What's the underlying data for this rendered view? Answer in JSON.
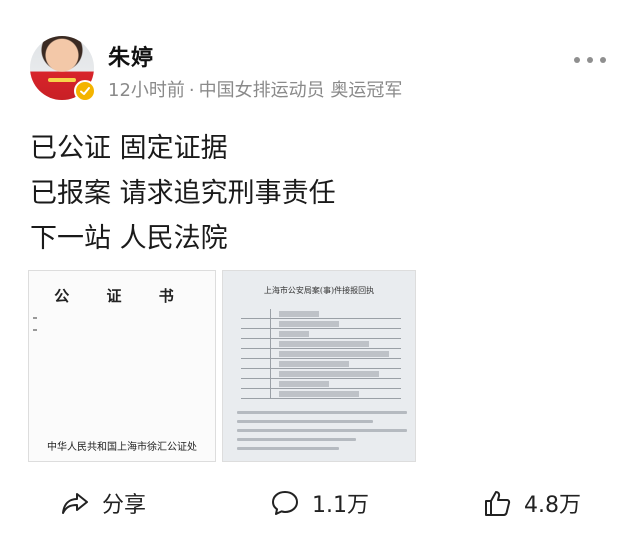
{
  "post": {
    "author": {
      "name": "朱婷",
      "verified": true
    },
    "meta": {
      "time": "12小时前",
      "separator": "·",
      "bio": "中国女排运动员 奥运冠军"
    },
    "text_lines": [
      "已公证 固定证据",
      "已报案 请求追究刑事责任",
      "下一站 人民法院"
    ],
    "images": [
      {
        "title": "公 证 书",
        "footer": "中华人民共和国上海市徐汇公证处"
      },
      {
        "title": "上海市公安局案(事)件接报回执"
      }
    ]
  },
  "actions": {
    "share": {
      "label": "分享",
      "icon": "share-icon"
    },
    "comment": {
      "label": "1.1万",
      "icon": "comment-icon"
    },
    "like": {
      "label": "4.8万",
      "icon": "thumbs-up-icon"
    }
  },
  "colors": {
    "meta_gray": "#8a8a8a",
    "verified_badge": "#f4b400",
    "text": "#1a1a1a"
  }
}
